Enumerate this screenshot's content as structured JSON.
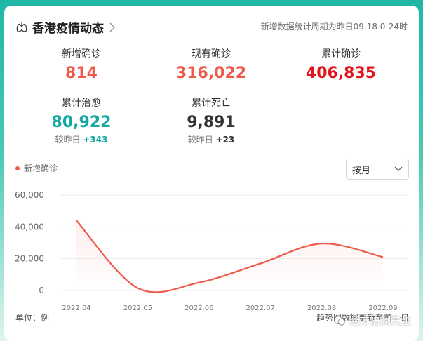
{
  "header": {
    "title": "香港疫情动态",
    "period": "新增数据统计周期为昨日09.18 0-24时"
  },
  "stats": [
    {
      "label": "新增确诊",
      "value": "814",
      "color": "#f0594a"
    },
    {
      "label": "现有确诊",
      "value": "316,022",
      "color": "#f0594a"
    },
    {
      "label": "累计确诊",
      "value": "406,835",
      "color": "#e5141b"
    },
    {
      "label": "累计治愈",
      "value": "80,922",
      "color": "#12a9a1",
      "delta_prefix": "较昨日",
      "delta_value": "+343",
      "delta_color": "#12a9a1"
    },
    {
      "label": "累计死亡",
      "value": "9,891",
      "color": "#333333",
      "delta_prefix": "较昨日",
      "delta_value": "+23",
      "delta_color": "#333333"
    }
  ],
  "legend": {
    "label": "新增确诊"
  },
  "range_select": {
    "value": "按月"
  },
  "chart_data": {
    "type": "line",
    "x": [
      "2022.04",
      "2022.05",
      "2022.06",
      "2022.07",
      "2022.08",
      "2022.09"
    ],
    "series": [
      {
        "name": "新增确诊",
        "values": [
          44000,
          1500,
          5000,
          17000,
          29500,
          21000
        ],
        "color": "#f0594a"
      }
    ],
    "ylim": [
      0,
      60000
    ],
    "yticks": [
      "0",
      "20,000",
      "40,000",
      "60,000"
    ],
    "grid": true
  },
  "footer": {
    "unit": "单位：例",
    "note": "趋势图数据更新至前一日"
  },
  "watermark": {
    "text": "经方悟澜先生"
  }
}
